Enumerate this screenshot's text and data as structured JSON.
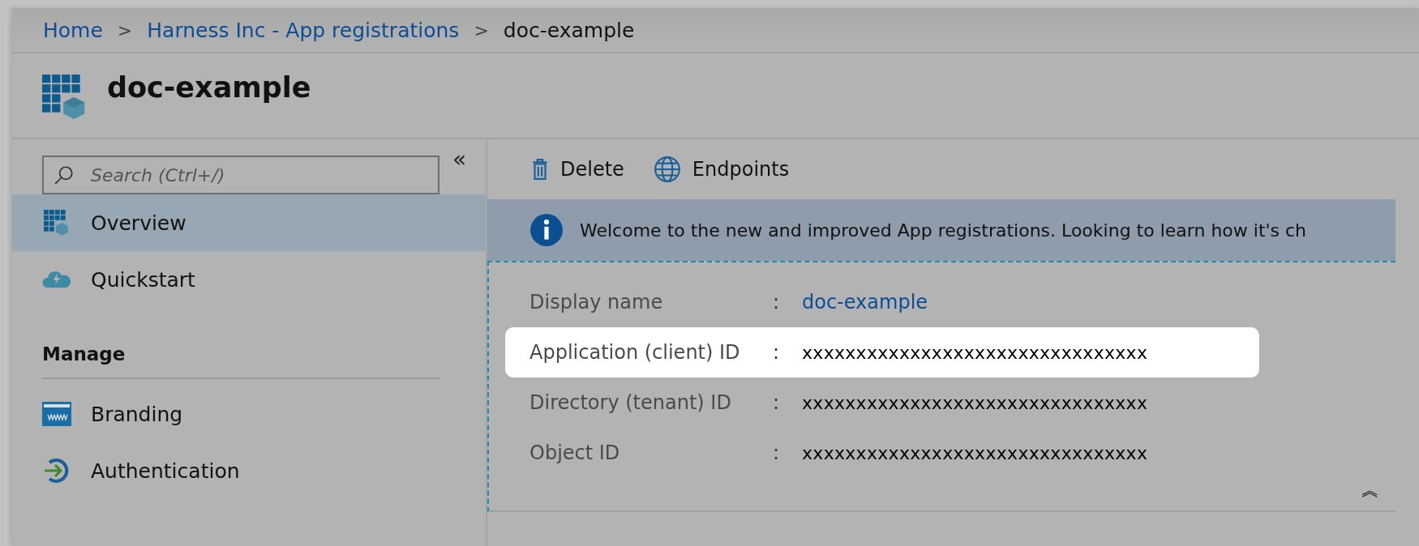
{
  "breadcrumb": [
    {
      "label": "Home",
      "kind": "link"
    },
    {
      "label": "Harness Inc - App registrations",
      "kind": "link"
    },
    {
      "label": "doc-example",
      "kind": "current"
    }
  ],
  "separator": ">",
  "title": "doc-example",
  "sidebar": {
    "collapse": "«",
    "search": {
      "placeholder": "Search (Ctrl+/)"
    },
    "items": [
      {
        "label": "Overview",
        "kind": "overview",
        "selected": true
      },
      {
        "label": "Quickstart",
        "kind": "quickstart",
        "selected": false
      }
    ],
    "section": "Manage",
    "section_items": [
      {
        "label": "Branding",
        "kind": "branding",
        "selected": false
      },
      {
        "label": "Authentication",
        "kind": "authentication",
        "selected": false
      }
    ]
  },
  "toolbar": [
    {
      "label": "Delete",
      "kind": "delete"
    },
    {
      "label": "Endpoints",
      "kind": "endpoints"
    }
  ],
  "banner": "Welcome to the new and improved App registrations. Looking to learn how it's ch",
  "details": [
    {
      "label": "Display name",
      "value": "doc-example",
      "kind": "link",
      "highlighted": false
    },
    {
      "label": "Application (client) ID",
      "value": "xxxxxxxxxxxxxxxxxxxxxxxxxxxxxxxx",
      "kind": "text",
      "highlighted": true
    },
    {
      "label": "Directory (tenant) ID",
      "value": "xxxxxxxxxxxxxxxxxxxxxxxxxxxxxxxx",
      "kind": "text",
      "highlighted": false
    },
    {
      "label": "Object ID",
      "value": "xxxxxxxxxxxxxxxxxxxxxxxxxxxxxxxx",
      "kind": "text",
      "highlighted": false
    }
  ],
  "separator_colon": ":",
  "collapse_details": "︽"
}
